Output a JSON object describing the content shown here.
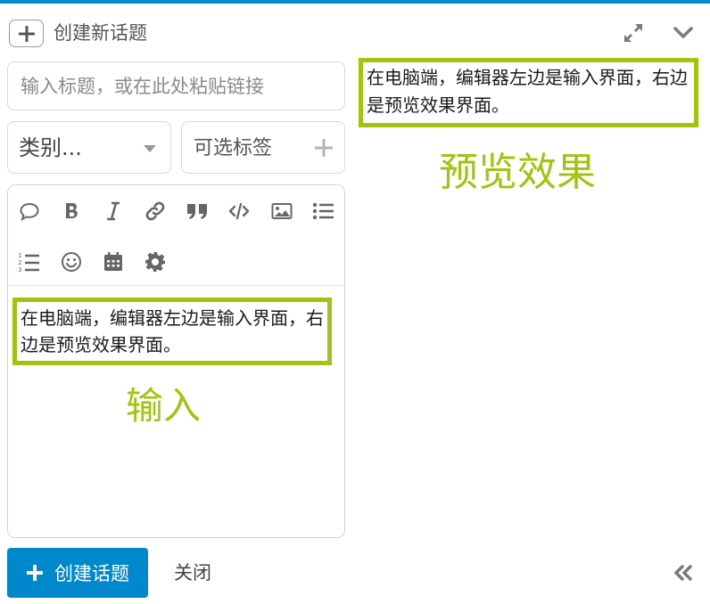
{
  "header": {
    "title": "创建新话题"
  },
  "title_field": {
    "placeholder": "输入标题，或在此处粘贴链接",
    "value": ""
  },
  "category": {
    "selected": "类别..."
  },
  "tags": {
    "placeholder": "可选标签"
  },
  "toolbar": {
    "buttons": [
      "quote-icon",
      "bold-icon",
      "italic-icon",
      "link-icon",
      "blockquote-icon",
      "code-icon",
      "image-icon",
      "bullet-list-icon",
      "numbered-list-icon",
      "emoji-icon",
      "calendar-icon",
      "gear-icon"
    ]
  },
  "editor": {
    "content": "在电脑端，编辑器左边是输入界面，右边是预览效果界面。",
    "annotation": "输入"
  },
  "preview": {
    "content": "在电脑端，编辑器左边是输入界面，右边是预览效果界面。",
    "annotation": "预览效果"
  },
  "footer": {
    "create_label": "创建话题",
    "close_label": "关闭"
  },
  "colors": {
    "accent": "#0088cc",
    "annotation_green": "#a1c411",
    "border": "#d9d9d9"
  }
}
